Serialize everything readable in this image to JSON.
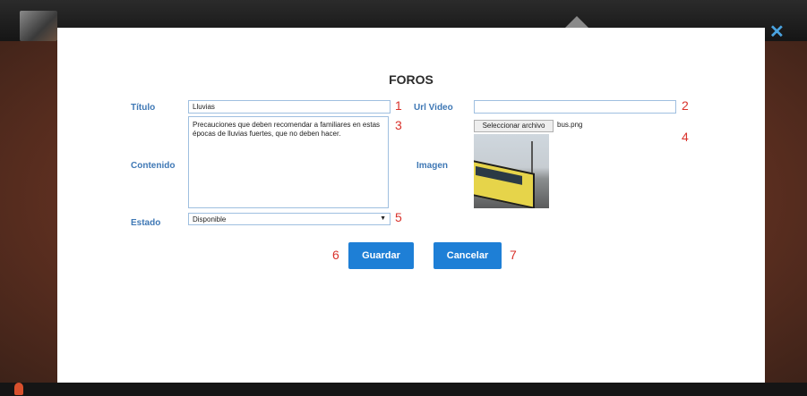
{
  "modal": {
    "title": "FOROS",
    "labels": {
      "titulo": "Título",
      "contenido": "Contenido",
      "estado": "Estado",
      "url_video": "Url Video",
      "imagen": "Imagen"
    },
    "fields": {
      "titulo_value": "Lluvias",
      "contenido_value": "Precauciones que deben recomendar a familiares en estas épocas de lluvias fuertes, que no deben hacer.",
      "url_video_value": "",
      "estado_value": "Disponible",
      "file_button": "Seleccionar archivo",
      "file_name": "bus.png"
    },
    "buttons": {
      "guardar": "Guardar",
      "cancelar": "Cancelar"
    },
    "callouts": [
      "1",
      "2",
      "3",
      "4",
      "5",
      "6",
      "7"
    ]
  },
  "colors": {
    "accent": "#1e7fd6",
    "label": "#3f78b5",
    "callout": "#d9322b",
    "close": "#4aa3e0"
  },
  "icons": [
    "close-icon",
    "home-icon",
    "person-icon",
    "dropdown-arrow-icon"
  ]
}
